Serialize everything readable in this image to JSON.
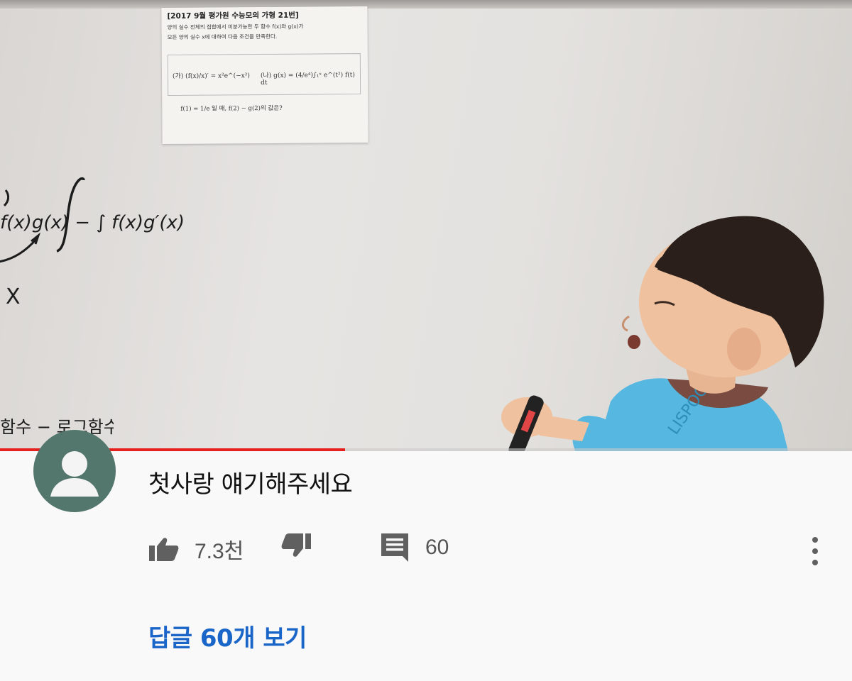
{
  "video": {
    "worksheet": {
      "title": "[2017 9월 평가원 수능모의 가형 21번]",
      "line1": "양의 실수 전체의 집합에서 미분가능한 두 함수 f(x)와 g(x)가",
      "line2": "모든 양의 실수 x에 대하여 다음 조건을 만족한다.",
      "condition_a": "(가) (f(x)/x)′ = x²e^(−x²)",
      "condition_b": "(나) g(x) = (4/e⁴)∫₁ˣ e^(t²) f(t) dt",
      "question": "f(1) = 1/e 일 때, f(2) − g(2)의 값은?"
    },
    "board_formula": "f(x)g(x) − ∫ f(x)g′(x)dx",
    "board_x": "X",
    "board_bottom": "함수 − 로그함수",
    "progress": 0.405
  },
  "comment": {
    "text": "첫사랑 얘기해주세요",
    "likes": "7.3천",
    "replies_count": "60",
    "view_replies_label": "답글 60개 보기"
  },
  "icons": {
    "like": "thumbs-up-icon",
    "dislike": "thumbs-down-icon",
    "reply": "comment-icon",
    "more": "more-vertical-icon",
    "avatar": "default-avatar-icon"
  },
  "colors": {
    "progress": "#e61f1f",
    "link": "#1a65c8",
    "avatar_bg": "#53776d"
  }
}
